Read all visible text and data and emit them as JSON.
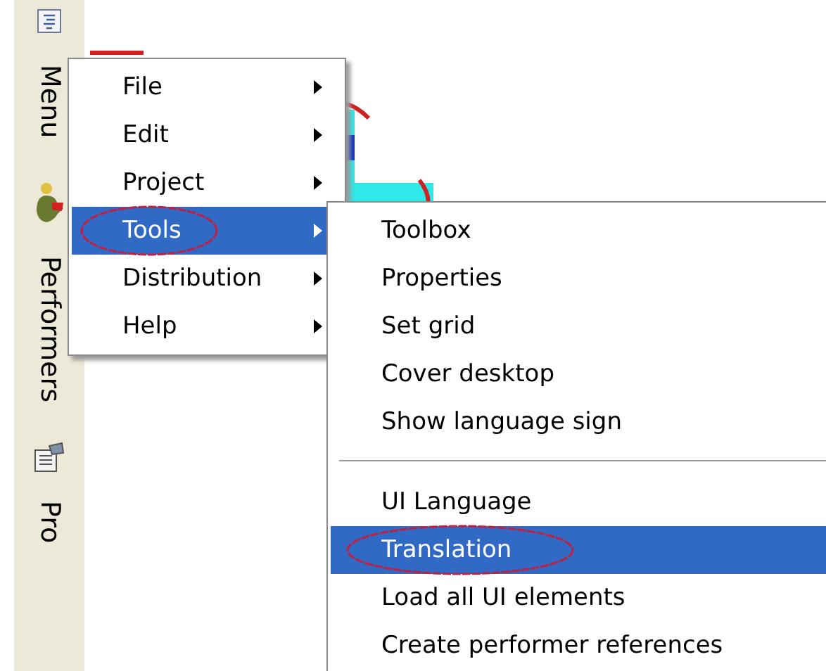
{
  "sidebar": {
    "tabs": [
      {
        "label": "Menu"
      },
      {
        "label": "Performers"
      },
      {
        "label": "Pro"
      }
    ]
  },
  "menu": {
    "items": [
      {
        "label": "File",
        "has_submenu": true,
        "selected": false
      },
      {
        "label": "Edit",
        "has_submenu": true,
        "selected": false
      },
      {
        "label": "Project",
        "has_submenu": true,
        "selected": false
      },
      {
        "label": "Tools",
        "has_submenu": true,
        "selected": true
      },
      {
        "label": "Distribution",
        "has_submenu": true,
        "selected": false
      },
      {
        "label": "Help",
        "has_submenu": true,
        "selected": false
      }
    ]
  },
  "submenu": {
    "groups": [
      [
        {
          "label": "Toolbox",
          "selected": false
        },
        {
          "label": "Properties",
          "selected": false
        },
        {
          "label": "Set grid",
          "selected": false
        },
        {
          "label": "Cover desktop",
          "selected": false
        },
        {
          "label": "Show language sign",
          "selected": false
        }
      ],
      [
        {
          "label": "UI Language",
          "selected": false
        },
        {
          "label": "Translation",
          "selected": true
        },
        {
          "label": "Load all UI elements",
          "selected": false
        },
        {
          "label": "Create performer references",
          "selected": false
        }
      ]
    ]
  }
}
